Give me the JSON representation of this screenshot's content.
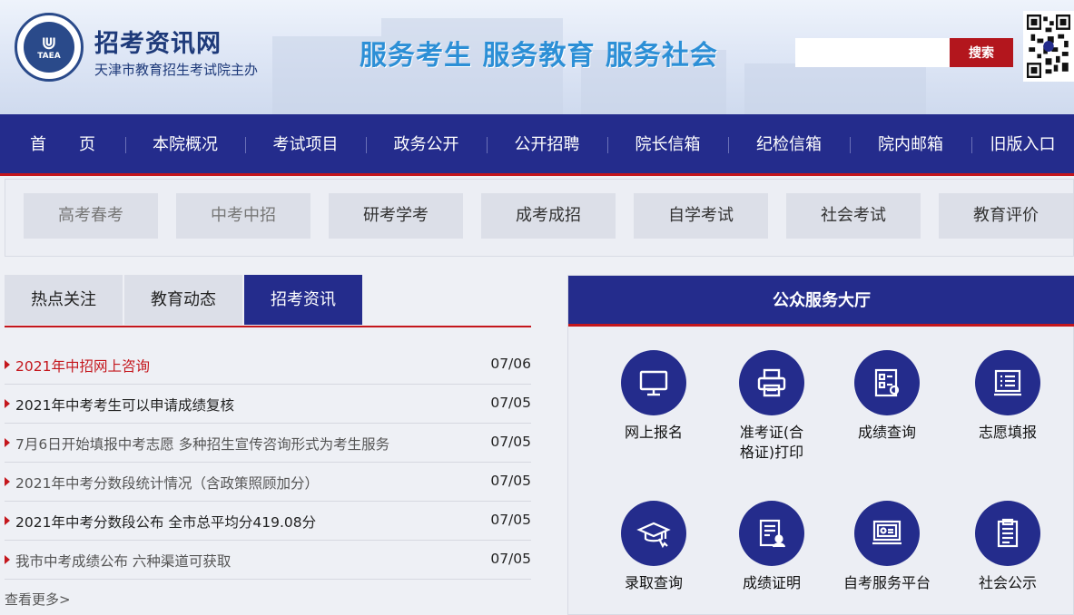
{
  "header": {
    "site_title": "招考资讯网",
    "site_subtitle": "天津市教育招生考试院主办",
    "logo_text": "TAEA",
    "slogan": "服务考生  服务教育  服务社会",
    "search_placeholder": "",
    "search_button": "搜索"
  },
  "nav": {
    "items": [
      "首　　页",
      "本院概况",
      "考试项目",
      "政务公开",
      "公开招聘",
      "院长信箱",
      "纪检信箱",
      "院内邮箱",
      "旧版入口"
    ]
  },
  "subnav": {
    "items": [
      "高考春考",
      "中考中招",
      "研考学考",
      "成考成招",
      "自学考试",
      "社会考试",
      "教育评价"
    ]
  },
  "tabs": {
    "items": [
      "热点关注",
      "教育动态",
      "招考资讯"
    ],
    "active_index": 2
  },
  "news": {
    "items": [
      {
        "title": "2021年中招网上咨询",
        "date": "07/06"
      },
      {
        "title": "2021年中考考生可以申请成绩复核",
        "date": "07/05"
      },
      {
        "title": "7月6日开始填报中考志愿 多种招生宣传咨询形式为考生服务",
        "date": "07/05"
      },
      {
        "title": "2021年中考分数段统计情况（含政策照顾加分）",
        "date": "07/05"
      },
      {
        "title": "2021年中考分数段公布 全市总平均分419.08分",
        "date": "07/05"
      },
      {
        "title": "我市中考成绩公布 六种渠道可获取",
        "date": "07/05"
      }
    ],
    "more": "查看更多>"
  },
  "service_hall": {
    "title": "公众服务大厅",
    "items": [
      {
        "label": "网上报名",
        "icon": "monitor-icon"
      },
      {
        "label": "准考证(合格证)打印",
        "icon": "printer-icon"
      },
      {
        "label": "成绩查询",
        "icon": "score-query-icon"
      },
      {
        "label": "志愿填报",
        "icon": "form-fill-icon"
      },
      {
        "label": "录取查询",
        "icon": "graduation-cap-icon"
      },
      {
        "label": "成绩证明",
        "icon": "certificate-icon"
      },
      {
        "label": "自考服务平台",
        "icon": "platform-icon"
      },
      {
        "label": "社会公示",
        "icon": "clipboard-icon"
      }
    ]
  },
  "colors": {
    "nav_blue": "#242c8c",
    "accent_red": "#c4161c",
    "slogan_blue": "#2c8fd6"
  }
}
